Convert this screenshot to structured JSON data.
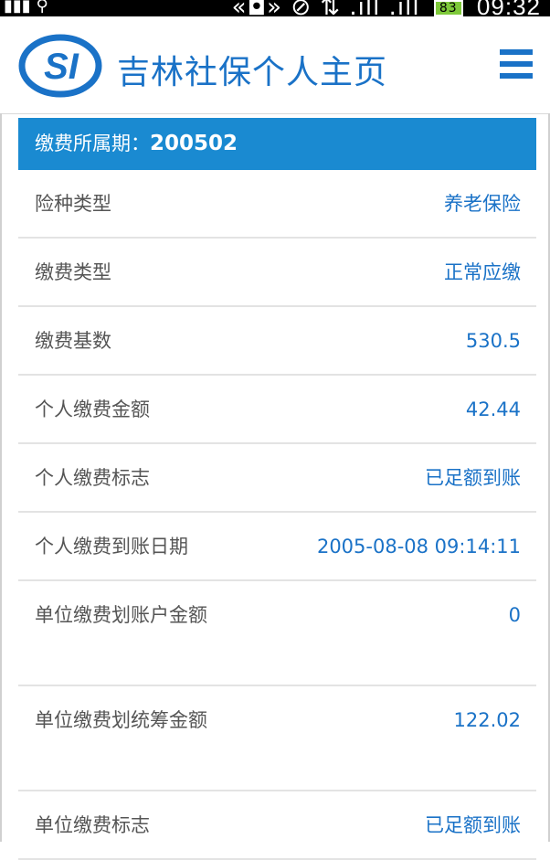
{
  "status_bar": {
    "time": "09:32",
    "battery": "83"
  },
  "header": {
    "logo_text": "SI",
    "title": "吉林社保个人主页",
    "menu_icon": "hamburger-menu-icon"
  },
  "period": {
    "label": "缴费所属期：",
    "value": "200502"
  },
  "rows": [
    {
      "label": "险种类型",
      "value": "养老保险"
    },
    {
      "label": "缴费类型",
      "value": "正常应缴"
    },
    {
      "label": "缴费基数",
      "value": "530.5"
    },
    {
      "label": "个人缴费金额",
      "value": "42.44"
    },
    {
      "label": "个人缴费标志",
      "value": "已足额到账"
    },
    {
      "label": "个人缴费到账日期",
      "value": "2005-08-08 09:14:11"
    },
    {
      "label": "单位缴费划账户金额",
      "value": "0"
    },
    {
      "label": "单位缴费划统筹金额",
      "value": "122.02"
    },
    {
      "label": "单位缴费标志",
      "value": "已足额到账"
    }
  ],
  "colors": {
    "brand_blue": "#1a72c7",
    "header_band": "#1a8ad1"
  }
}
